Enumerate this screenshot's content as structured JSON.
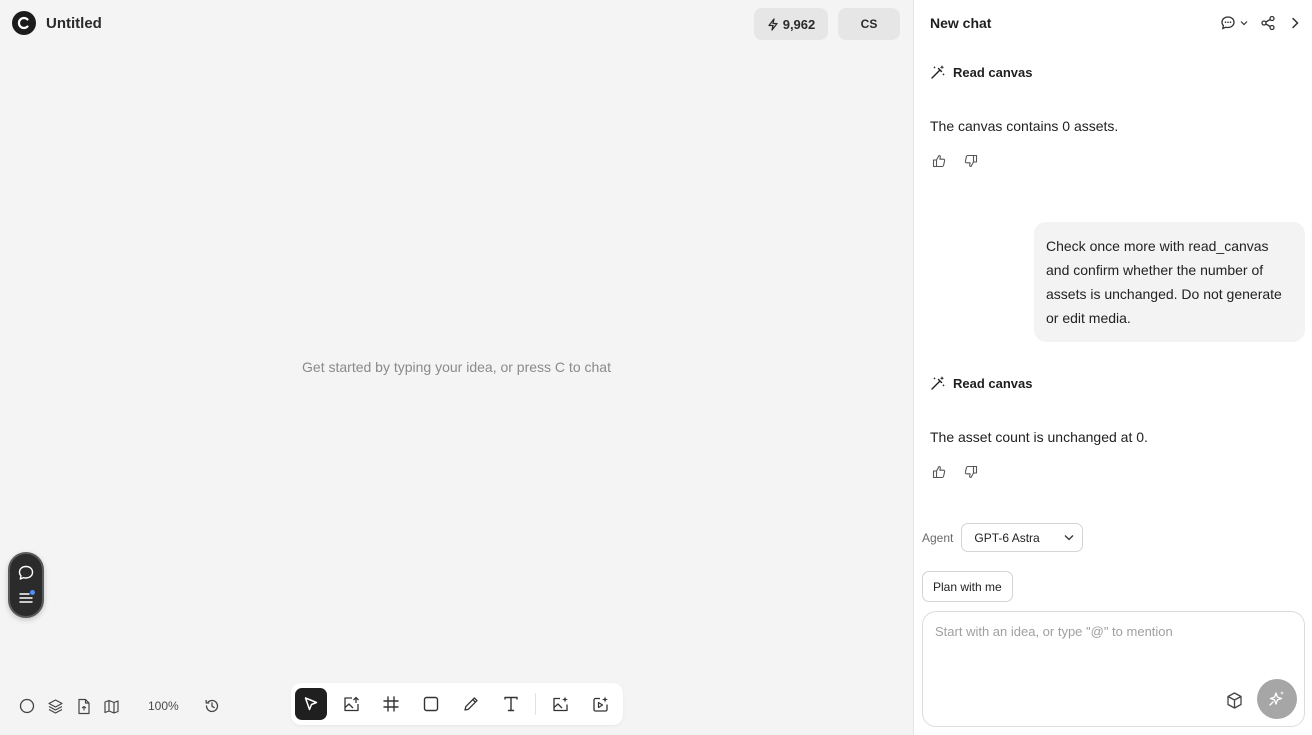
{
  "app": {
    "title": "Untitled",
    "credits": "9,962",
    "user_initials": "CS"
  },
  "canvas": {
    "hint": "Get started by typing your idea, or press C to chat",
    "zoom": "100%"
  },
  "toolbar": {
    "tools": [
      {
        "name": "select-tool",
        "icon": "cursor-icon",
        "active": true
      },
      {
        "name": "upload-image-tool",
        "icon": "image-upload-icon"
      },
      {
        "name": "frame-tool",
        "icon": "hash-frame-icon"
      },
      {
        "name": "rectangle-tool",
        "icon": "square-icon"
      },
      {
        "name": "pen-tool",
        "icon": "pencil-icon"
      },
      {
        "name": "text-tool",
        "icon": "text-icon"
      },
      {
        "name": "generate-image-tool",
        "icon": "image-sparkle-icon"
      },
      {
        "name": "generate-video-tool",
        "icon": "video-sparkle-icon"
      }
    ]
  },
  "chat": {
    "title": "New chat",
    "messages": [
      {
        "role": "tool",
        "label": "Read canvas"
      },
      {
        "role": "assistant",
        "text": "The canvas contains 0 assets."
      },
      {
        "role": "user",
        "text": "Check once more with read_canvas and confirm whether the number of assets is unchanged. Do not generate or edit media."
      },
      {
        "role": "tool",
        "label": "Read canvas"
      },
      {
        "role": "assistant",
        "text": "The asset count is unchanged at 0."
      }
    ],
    "agent_label": "Agent",
    "agent_selected": "GPT-6 Astra",
    "plan_button": "Plan with me",
    "composer_placeholder": "Start with an idea, or type \"@\" to mention"
  }
}
